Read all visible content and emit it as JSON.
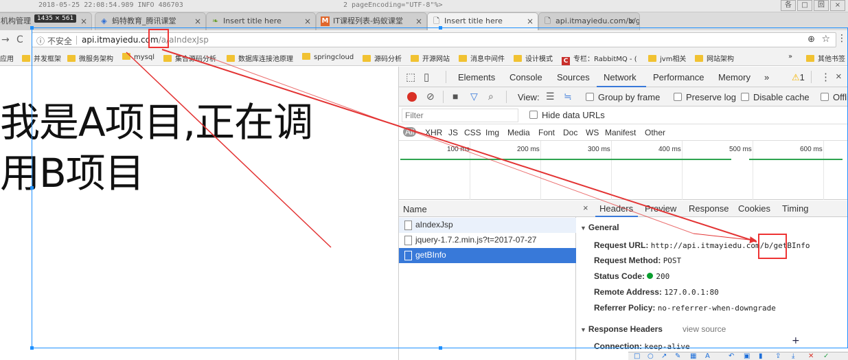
{
  "window": {
    "topline_text": "2018-05-25 22:08:54.989  INFO 486703",
    "topline_text2": "2      pageEncoding=\"UTF-8\"%>",
    "size_badge": "1435 × 561",
    "win_buttons": [
      "各",
      "□",
      "回",
      "×"
    ]
  },
  "tabs": [
    {
      "label": "机构管理",
      "icon": "page-icon"
    },
    {
      "label": "蚂特教育_腾讯课堂",
      "icon": "shield-icon"
    },
    {
      "label": "Insert title here",
      "icon": "leaf-icon"
    },
    {
      "label": "IT课程列表-蚂蚁课堂",
      "icon": "m-icon"
    },
    {
      "label": "Insert title here",
      "icon": "page-icon"
    },
    {
      "label": "api.itmayiedu.com/b/g",
      "icon": "page-icon"
    }
  ],
  "addressbar": {
    "insecure_label": "不安全",
    "url_host": "api.itmayiedu.com",
    "url_path": "/a/aIndexJsp"
  },
  "bookmarks": [
    {
      "label": "应用",
      "kind": "apps"
    },
    {
      "label": "并发框架",
      "kind": "folder"
    },
    {
      "label": "微服务架构",
      "kind": "folder"
    },
    {
      "label": "mysql",
      "kind": "folder"
    },
    {
      "label": "集合源码分析",
      "kind": "folder"
    },
    {
      "label": "数据库连接池原理",
      "kind": "folder"
    },
    {
      "label": "springcloud",
      "kind": "folder"
    },
    {
      "label": "源码分析",
      "kind": "folder"
    },
    {
      "label": "开源网站",
      "kind": "folder"
    },
    {
      "label": "消息中间件",
      "kind": "folder"
    },
    {
      "label": "设计模式",
      "kind": "folder"
    },
    {
      "label": "专栏：RabbitMQ - (",
      "kind": "logo"
    },
    {
      "label": "jvm相关",
      "kind": "folder"
    },
    {
      "label": "网站架构",
      "kind": "folder"
    },
    {
      "label": "»",
      "kind": "more"
    },
    {
      "label": "其他书签",
      "kind": "folder"
    }
  ],
  "page": {
    "line1": "我是A项目,正在调",
    "line2": "用B项目"
  },
  "devtools": {
    "tabs": [
      "Elements",
      "Console",
      "Sources",
      "Network",
      "Performance",
      "Memory",
      "»"
    ],
    "active_tab": "Network",
    "warnings": "1",
    "toolbar": {
      "view_label": "View:",
      "group_by_frame": "Group by frame",
      "preserve_log": "Preserve log",
      "disable_cache": "Disable cache",
      "offline": "Offli"
    },
    "filter_placeholder": "Filter",
    "hide_data_urls": "Hide data URLs",
    "types": [
      "All",
      "XHR",
      "JS",
      "CSS",
      "Img",
      "Media",
      "Font",
      "Doc",
      "WS",
      "Manifest",
      "Other"
    ],
    "timeline_ticks": [
      "100 ms",
      "200 ms",
      "300 ms",
      "400 ms",
      "500 ms",
      "600 ms"
    ],
    "requests_header": "Name",
    "requests": [
      "aIndexJsp",
      "jquery-1.7.2.min.js?t=2017-07-27",
      "getBInfo"
    ],
    "selected_request": "getBInfo",
    "detail_tabs": [
      "×",
      "Headers",
      "Preview",
      "Response",
      "Cookies",
      "Timing"
    ],
    "general_title": "General",
    "general": [
      {
        "key": "Request URL:",
        "value": "http://api.itmayiedu.com/b/getBInfo"
      },
      {
        "key": "Request Method:",
        "value": "POST"
      },
      {
        "key": "Status Code:",
        "value": "200"
      },
      {
        "key": "Remote Address:",
        "value": "127.0.0.1:80"
      },
      {
        "key": "Referrer Policy:",
        "value": "no-referrer-when-downgrade"
      }
    ],
    "response_headers_title": "Response Headers",
    "view_source": "view source",
    "connection": {
      "key": "Connection:",
      "value": "keep-alive"
    }
  },
  "annotation_color": "#e33333",
  "selection_color": "#1e90ff"
}
